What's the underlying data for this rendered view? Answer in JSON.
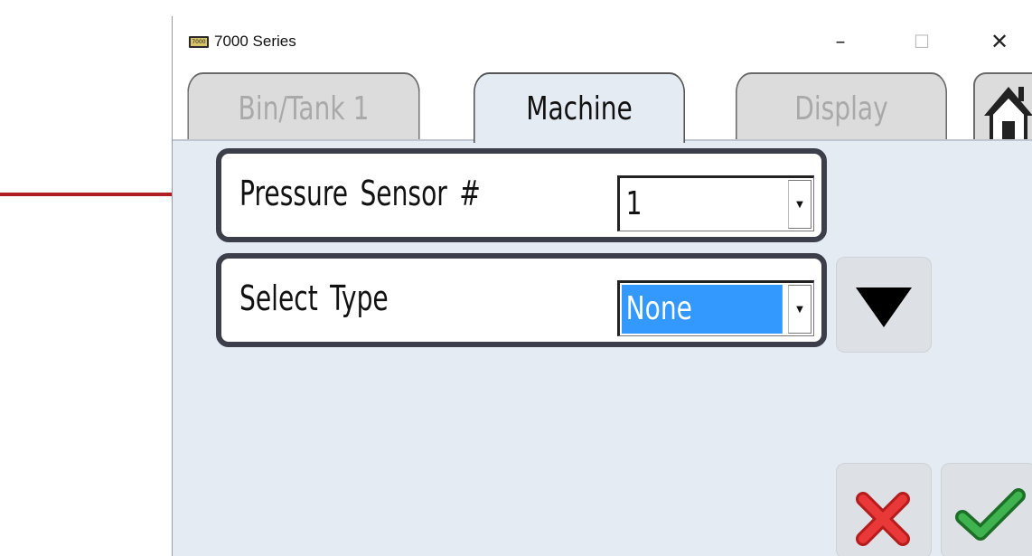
{
  "window": {
    "title": "7000 Series",
    "icon_label": "7000"
  },
  "tabs": [
    {
      "label": "Bin/Tank 1",
      "active": false
    },
    {
      "label": "Machine",
      "active": true
    },
    {
      "label": "Display",
      "active": false
    }
  ],
  "icons": {
    "home": "home-icon",
    "expand": "triangle-down-icon",
    "cancel": "red-x-icon",
    "confirm": "green-check-icon",
    "annotation": "red-arrow-icon"
  },
  "fields": {
    "pressure_sensor": {
      "label": "Pressure Sensor #",
      "value": "1"
    },
    "select_type": {
      "label": "Select Type",
      "value": "None"
    }
  },
  "colors": {
    "annotation_arrow": "#b01e23",
    "content_bg": "#e5ebf2",
    "selection": "#3399ff",
    "cancel": "#d92b2b",
    "confirm": "#2e9a3a"
  }
}
